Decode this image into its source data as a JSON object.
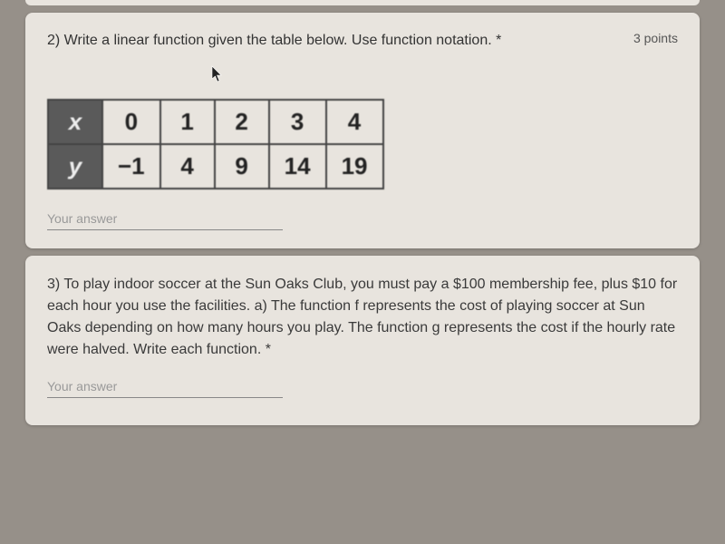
{
  "q2": {
    "prompt": "2) Write a linear function given the table below. Use function notation. *",
    "points": "3 points",
    "table": {
      "row_x_header": "x",
      "row_y_header": "y",
      "x": [
        "0",
        "1",
        "2",
        "3",
        "4"
      ],
      "y": [
        "−1",
        "4",
        "9",
        "14",
        "19"
      ]
    },
    "answer_placeholder": "Your answer"
  },
  "q3": {
    "prompt": "3) To play indoor soccer at the Sun Oaks Club, you must pay a $100 membership fee, plus $10 for each hour you use the facilities. a) The function f represents the cost of playing soccer at Sun Oaks depending on how many hours you play. The function g represents the cost if the hourly rate were halved. Write each function. *",
    "answer_placeholder": "Your answer"
  }
}
